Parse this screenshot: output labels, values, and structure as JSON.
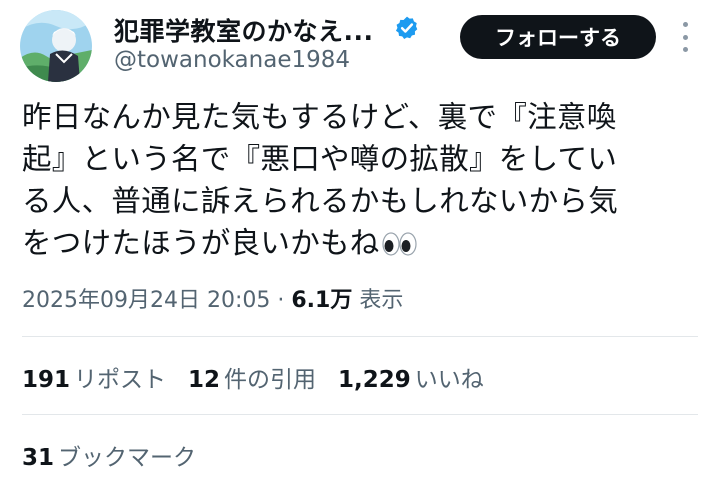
{
  "author": {
    "display_name": "犯罪学教室のかなえ...",
    "handle": "@towanokanae1984",
    "verified_icon": "verified-badge-icon",
    "avatar_icon": "avatar"
  },
  "actions": {
    "follow_label": "フォローする",
    "more_icon": "more-options-icon"
  },
  "tweet": {
    "text": "昨日なんか見た気もするけど、裏で『注意喚\n起』という名で『悪口や噂の拡散』をしてい\nる人、普通に訴えられるかもしれないから気\nをつけたほうが良いかもね",
    "emoji": "eyes-emoji",
    "timestamp": "2025年09月24日 20:05",
    "separator": "·",
    "views_count": "6.1万",
    "views_label": "表示"
  },
  "stats": {
    "reposts_count": "191",
    "reposts_label": "リポスト",
    "quotes_count": "12",
    "quotes_label": "件の引用",
    "likes_count": "1,229",
    "likes_label": "いいね",
    "bookmarks_count": "31",
    "bookmarks_label": "ブックマーク"
  },
  "colors": {
    "text": "#0f1419",
    "secondary": "#536471",
    "verified": "#1d9bf0",
    "divider": "#e3e7ea",
    "button_bg": "#0f1419"
  }
}
